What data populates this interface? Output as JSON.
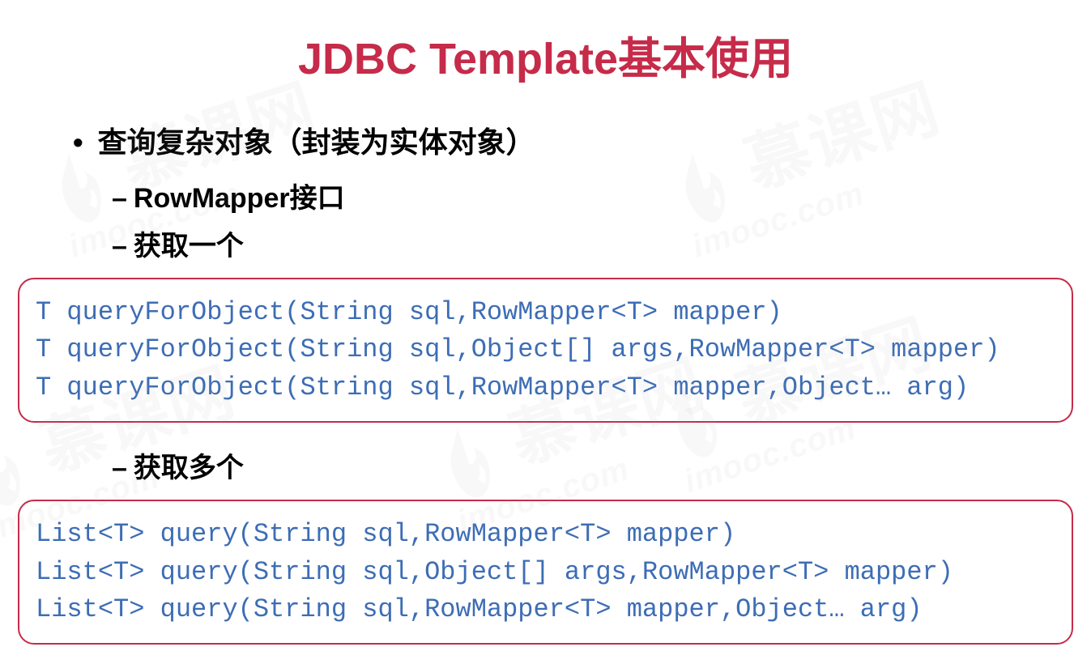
{
  "title": "JDBC Template基本使用",
  "bullet": "查询复杂对象（封装为实体对象）",
  "dash1": "RowMapper接口",
  "dash2": "获取一个",
  "dash3": "获取多个",
  "code1": {
    "line1": "T queryForObject(String sql,RowMapper<T> mapper)",
    "line2": "T queryForObject(String sql,Object[] args,RowMapper<T> mapper)",
    "line3": "T queryForObject(String sql,RowMapper<T> mapper,Object… arg)"
  },
  "code2": {
    "line1": "List<T> query(String sql,RowMapper<T> mapper)",
    "line2": "List<T> query(String sql,Object[] args,RowMapper<T> mapper)",
    "line3": "List<T> query(String sql,RowMapper<T> mapper,Object… arg)"
  },
  "watermark": {
    "brand": "慕课网",
    "url": "imooc.com"
  }
}
